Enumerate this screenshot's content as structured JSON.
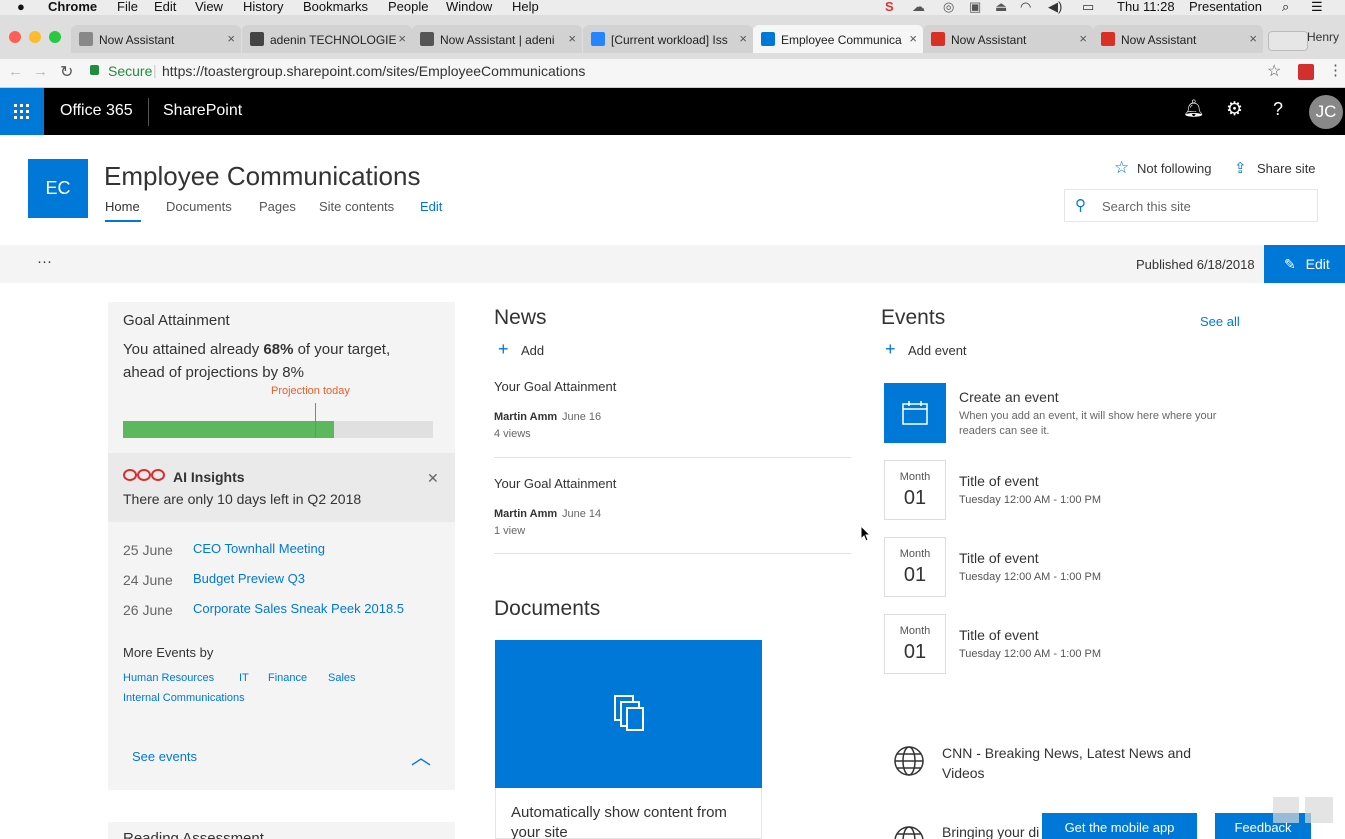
{
  "macbar": {
    "app": "Chrome",
    "menus": [
      "File",
      "Edit",
      "View",
      "History",
      "Bookmarks",
      "People",
      "Window",
      "Help"
    ],
    "clock": "Thu 11:28",
    "mode": "Presentation"
  },
  "tabs": [
    {
      "label": "Now Assistant",
      "icon": "page-icon",
      "color": "#888888"
    },
    {
      "label": "adenin TECHNOLOGIE",
      "icon": "wordpress-icon",
      "color": "#444444"
    },
    {
      "label": "Now Assistant | adeni",
      "icon": "hash-icon",
      "color": "#555555"
    },
    {
      "label": "[Current workload] Iss",
      "icon": "jira-icon",
      "color": "#2684ff"
    },
    {
      "label": "Employee Communica",
      "icon": "sharepoint-icon",
      "color": "#0078d7"
    },
    {
      "label": "Now Assistant",
      "icon": "gmail-icon",
      "color": "#d93025"
    },
    {
      "label": "Now Assistant",
      "icon": "gmail-icon",
      "color": "#d93025"
    }
  ],
  "profile_name": "Henry",
  "address": {
    "secure_label": "Secure",
    "url": "https://toastergroup.sharepoint.com/sites/EmployeeCommunications"
  },
  "suite": {
    "office": "Office 365",
    "app": "SharePoint",
    "avatar": "JC"
  },
  "site": {
    "logo": "EC",
    "title": "Employee Communications",
    "nav": [
      "Home",
      "Documents",
      "Pages",
      "Site contents",
      "Edit"
    ],
    "follow": "Not following",
    "share": "Share site",
    "search_placeholder": "Search this site"
  },
  "cmdbar": {
    "more": "···",
    "published": "Published 6/18/2018",
    "edit": "Edit"
  },
  "goal": {
    "title": "Goal Attainment",
    "text_prefix": "You attained already ",
    "percent": "68%",
    "text_suffix": " of your target,",
    "line2": "ahead of projections by 8%",
    "projection_label": "Projection today",
    "progress": 0.68,
    "projection": 0.62
  },
  "insights": {
    "title": "AI Insights",
    "message": "There are only 10 days left in Q2 2018"
  },
  "upcoming": [
    {
      "date": "25 June",
      "title": "CEO Townhall Meeting"
    },
    {
      "date": "24 June",
      "title": "Budget Preview Q3"
    },
    {
      "date": "26 June",
      "title": "Corporate Sales Sneak Peek 2018.5"
    }
  ],
  "more_events": {
    "label": "More Events by",
    "tags": [
      "Human Resources",
      "IT",
      "Finance",
      "Sales",
      "Internal Communications"
    ],
    "see_events": "See events"
  },
  "next_section": "Reading Assessment",
  "news": {
    "title": "News",
    "add": "Add",
    "items": [
      {
        "title": "Your Goal Attainment",
        "author": "Martin Amm",
        "date": "June 16",
        "views": "4 views"
      },
      {
        "title": "Your Goal Attainment",
        "author": "Martin Amm",
        "date": "June 14",
        "views": "1 view"
      }
    ]
  },
  "documents": {
    "title": "Documents",
    "caption": "Automatically show content from your site"
  },
  "events": {
    "title": "Events",
    "see_all": "See all",
    "add": "Add event",
    "create_title": "Create an event",
    "create_desc": "When you add an event, it will show here where your readers can see it.",
    "items": [
      {
        "month": "Month",
        "day": "01",
        "title": "Title of event",
        "time": "Tuesday 12:00 AM - 1:00 PM"
      },
      {
        "month": "Month",
        "day": "01",
        "title": "Title of event",
        "time": "Tuesday 12:00 AM - 1:00 PM"
      },
      {
        "month": "Month",
        "day": "01",
        "title": "Title of event",
        "time": "Tuesday 12:00 AM - 1:00 PM"
      }
    ]
  },
  "links": [
    {
      "title": "CNN - Breaking News, Latest News and Videos"
    },
    {
      "title": "Bringing your di"
    }
  ],
  "footer": {
    "mobile": "Get the mobile app",
    "feedback": "Feedback"
  },
  "colors": {
    "accent": "#0078d7",
    "progress": "#5cb85c",
    "projection": "#e8602c"
  }
}
